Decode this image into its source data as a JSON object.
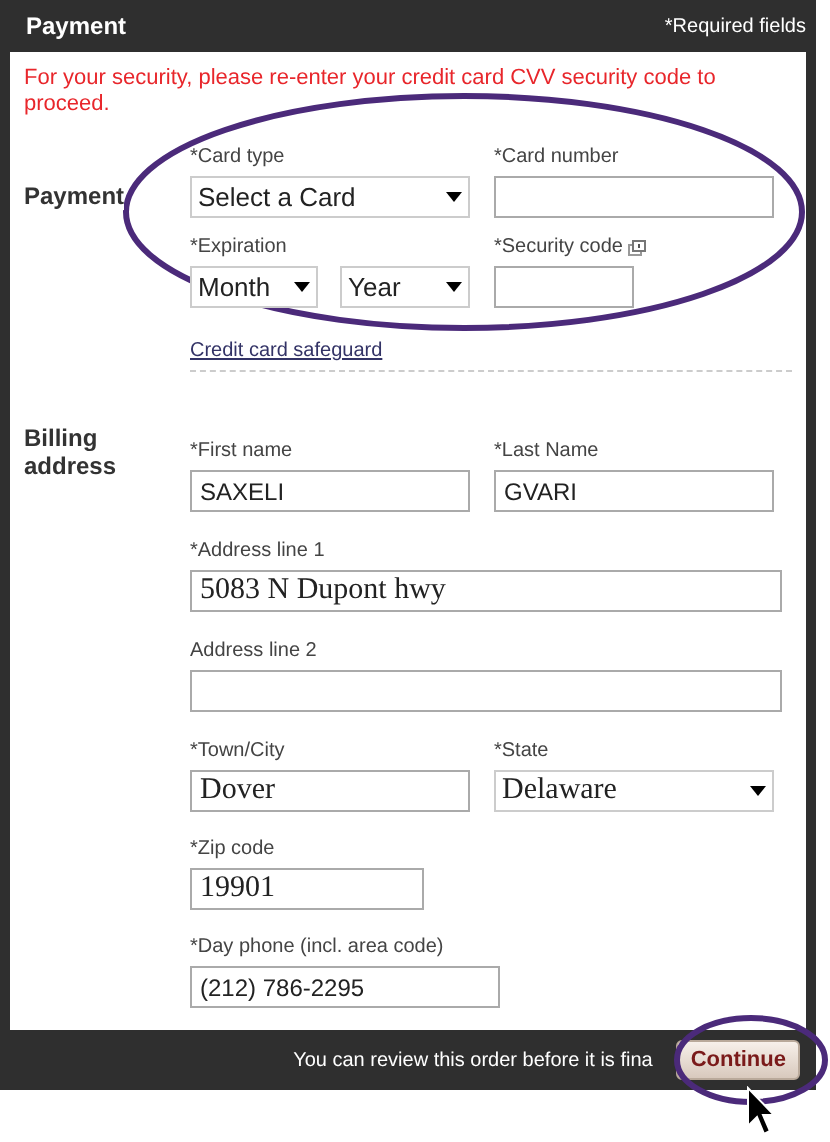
{
  "header": {
    "title": "Payment",
    "required_note": "*Required fields"
  },
  "security_notice": "For your security, please re-enter your credit card CVV security code to proceed.",
  "payment": {
    "label": "Payment",
    "card_type": {
      "label": "*Card type",
      "value": "Select a Card"
    },
    "card_number": {
      "label": "*Card number"
    },
    "expiration": {
      "label": "*Expiration",
      "month": "Month",
      "year": "Year"
    },
    "security_code": {
      "label": "*Security code"
    },
    "link": "Credit card safeguard"
  },
  "billing": {
    "label": "Billing address",
    "first_name": {
      "label": "*First name",
      "value": "SAXELI"
    },
    "last_name": {
      "label": "*Last Name",
      "value": "GVARI"
    },
    "address_line_1": {
      "label": "*Address line 1",
      "value": "5083 N Dupont hwy"
    },
    "address_line_2": {
      "label": "Address line 2"
    },
    "town": {
      "label": "*Town/City",
      "value": "Dover"
    },
    "state": {
      "label": "*State",
      "value": "Delaware"
    },
    "zip": {
      "label": "*Zip code",
      "value": "19901"
    },
    "phone": {
      "label": "*Day phone (incl. area code)",
      "value": "(212) 786-2295"
    }
  },
  "footer": {
    "note": "You can review this order before it is fina",
    "button": "Continue"
  }
}
